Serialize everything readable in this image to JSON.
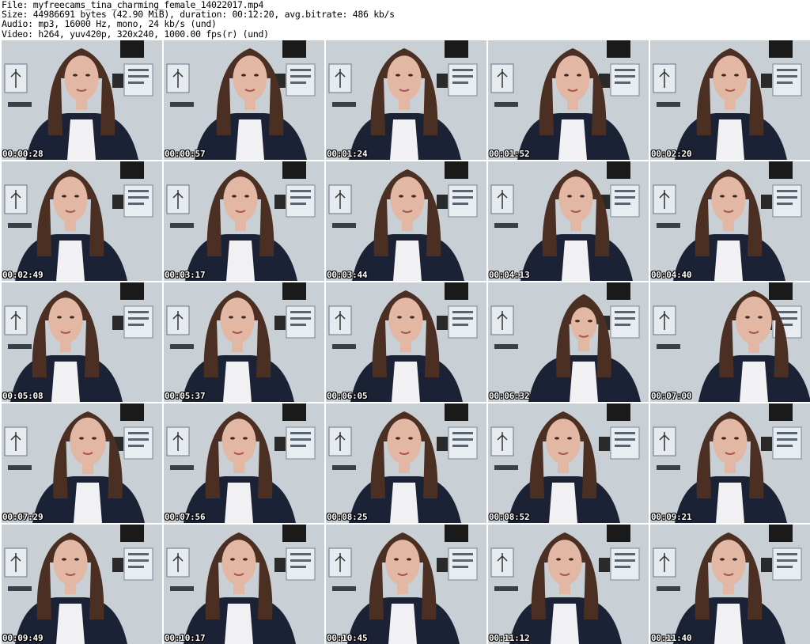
{
  "header": {
    "file": "File: myfreecams_tina_charming_female_14022017.mp4",
    "size": "Size: 44986691 bytes (42.90 MiB), duration: 00:12:20, avg.bitrate: 486 kb/s",
    "audio": "Audio: mp3, 16000 Hz, mono, 24 kb/s (und)",
    "video": "Video: h264, yuv420p, 320x240, 1000.00 fps(r) (und)"
  },
  "thumbnails": [
    {
      "timestamp": "00:00:28"
    },
    {
      "timestamp": "00:00:57"
    },
    {
      "timestamp": "00:01:24"
    },
    {
      "timestamp": "00:01:52"
    },
    {
      "timestamp": "00:02:20"
    },
    {
      "timestamp": "00:02:49"
    },
    {
      "timestamp": "00:03:17"
    },
    {
      "timestamp": "00:03:44"
    },
    {
      "timestamp": "00:04:13"
    },
    {
      "timestamp": "00:04:40"
    },
    {
      "timestamp": "00:05:08"
    },
    {
      "timestamp": "00:05:37"
    },
    {
      "timestamp": "00:06:05"
    },
    {
      "timestamp": "00:06:32"
    },
    {
      "timestamp": "00:07:00"
    },
    {
      "timestamp": "00:07:29"
    },
    {
      "timestamp": "00:07:56"
    },
    {
      "timestamp": "00:08:25"
    },
    {
      "timestamp": "00:08:52"
    },
    {
      "timestamp": "00:09:21"
    },
    {
      "timestamp": "00:09:49"
    },
    {
      "timestamp": "00:10:17"
    },
    {
      "timestamp": "00:10:45"
    },
    {
      "timestamp": "00:11:12"
    },
    {
      "timestamp": "00:11:40"
    }
  ],
  "colors": {
    "wall": "#c8cfd5",
    "hair": "#4a2f22",
    "skin": "#e2b8a4",
    "jacket": "#1b2235",
    "shirt": "#f1f0f2"
  }
}
